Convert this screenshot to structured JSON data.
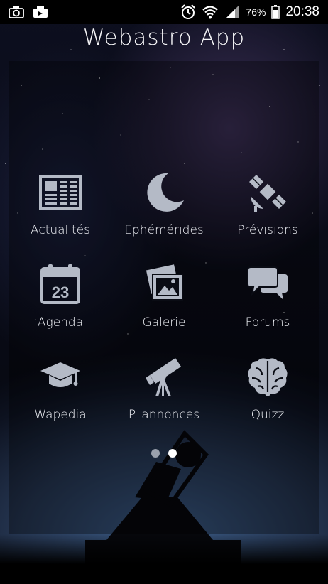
{
  "status_bar": {
    "battery": "76%",
    "time": "20:38"
  },
  "app": {
    "title": "Webastro App"
  },
  "menu": [
    {
      "label": "Actualités",
      "icon": "newspaper-icon"
    },
    {
      "label": "Ephémérides",
      "icon": "moon-icon"
    },
    {
      "label": "Prévisions",
      "icon": "satellite-icon"
    },
    {
      "label": "Agenda",
      "icon": "calendar-icon",
      "badge": "23"
    },
    {
      "label": "Galerie",
      "icon": "photos-icon"
    },
    {
      "label": "Forums",
      "icon": "chat-bubbles-icon"
    },
    {
      "label": "Wapedia",
      "icon": "graduation-cap-icon"
    },
    {
      "label": "P. annonces",
      "icon": "telescope-icon"
    },
    {
      "label": "Quizz",
      "icon": "brain-icon"
    }
  ],
  "pager": {
    "pages": 2,
    "active_index": 1
  },
  "colors": {
    "icon": "#b4bac6",
    "label": "#eef0f5",
    "dot_inactive": "#9aa0ac",
    "dot_active": "#ffffff"
  }
}
